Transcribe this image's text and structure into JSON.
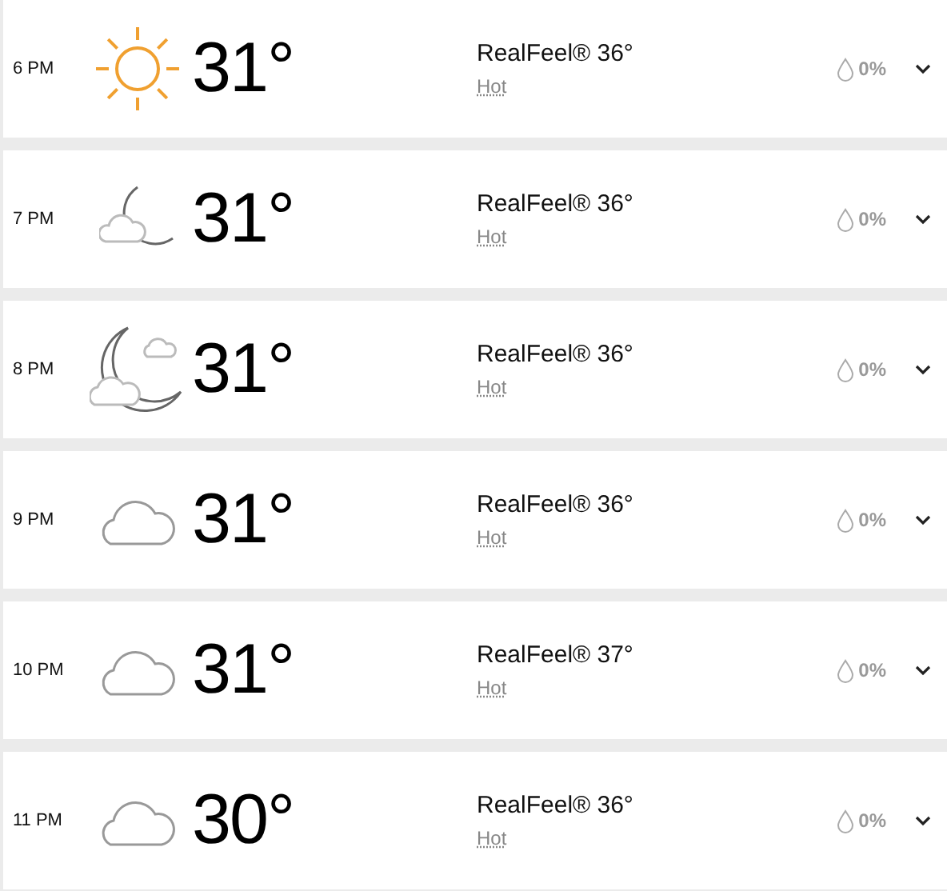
{
  "hours": [
    {
      "time": "6 PM",
      "kind": "sunny",
      "temp": "31°",
      "realfeel": "RealFeel® 36°",
      "phrase": "Hot",
      "precip": "0%"
    },
    {
      "time": "7 PM",
      "kind": "night-partly",
      "temp": "31°",
      "realfeel": "RealFeel® 36°",
      "phrase": "Hot",
      "precip": "0%"
    },
    {
      "time": "8 PM",
      "kind": "night-clouds",
      "temp": "31°",
      "realfeel": "RealFeel® 36°",
      "phrase": "Hot",
      "precip": "0%"
    },
    {
      "time": "9 PM",
      "kind": "cloudy",
      "temp": "31°",
      "realfeel": "RealFeel® 36°",
      "phrase": "Hot",
      "precip": "0%"
    },
    {
      "time": "10 PM",
      "kind": "cloudy",
      "temp": "31°",
      "realfeel": "RealFeel® 37°",
      "phrase": "Hot",
      "precip": "0%"
    },
    {
      "time": "11 PM",
      "kind": "cloudy",
      "temp": "30°",
      "realfeel": "RealFeel® 36°",
      "phrase": "Hot",
      "precip": "0%"
    }
  ]
}
